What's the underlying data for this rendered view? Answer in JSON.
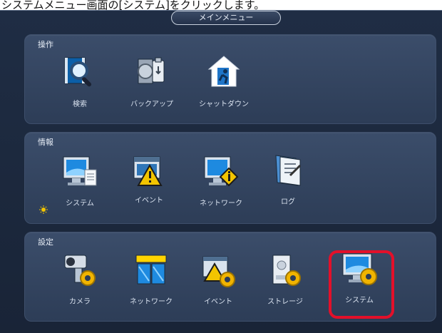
{
  "top_caption": "システムメニュー画面の[システム]をクリックします。",
  "window": {
    "title": "メインメニュー"
  },
  "sections": {
    "operation": {
      "title": "操作",
      "items": [
        {
          "label": "検索",
          "icon": "search-icon"
        },
        {
          "label": "バックアップ",
          "icon": "backup-icon"
        },
        {
          "label": "シャットダウン",
          "icon": "shutdown-icon"
        }
      ]
    },
    "info": {
      "title": "情報",
      "items": [
        {
          "label": "システム",
          "icon": "system-info-icon"
        },
        {
          "label": "イベント",
          "icon": "event-info-icon"
        },
        {
          "label": "ネットワーク",
          "icon": "network-info-icon"
        },
        {
          "label": "ログ",
          "icon": "log-icon"
        }
      ]
    },
    "settings": {
      "title": "設定",
      "items": [
        {
          "label": "カメラ",
          "icon": "camera-settings-icon"
        },
        {
          "label": "ネットワーク",
          "icon": "network-settings-icon"
        },
        {
          "label": "イベント",
          "icon": "event-settings-icon"
        },
        {
          "label": "ストレージ",
          "icon": "storage-settings-icon"
        },
        {
          "label": "システム",
          "icon": "system-settings-icon"
        }
      ]
    }
  },
  "colors": {
    "background": "#1f2d44",
    "panel": "#34465f",
    "highlight": "#e3102a",
    "icon_blue": "#2d8fd6",
    "gear_yellow": "#f1b400"
  }
}
